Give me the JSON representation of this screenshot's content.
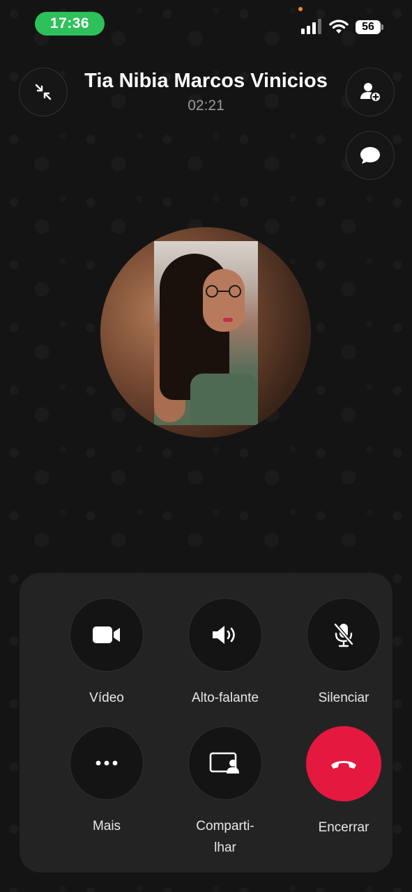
{
  "status_bar": {
    "time": "17:36",
    "battery_level": "56",
    "signal_icon": "cellular-signal-icon",
    "wifi_icon": "wifi-icon"
  },
  "call": {
    "contact_name": "Tia Nibia Marcos Vinicios",
    "duration": "02:21"
  },
  "header_actions": {
    "minimize_icon": "minimize-arrows-icon",
    "add_person_icon": "add-person-icon",
    "chat_icon": "chat-bubble-icon"
  },
  "controls": {
    "video": "Vídeo",
    "speaker": "Alto-falante",
    "mute": "Silenciar",
    "more": "Mais",
    "share_line1": "Comparti-",
    "share_line2": "lhar",
    "end": "Encerrar"
  },
  "colors": {
    "background": "#141414",
    "time_pill": "#2ec05b",
    "end_call": "#e5183f",
    "panel": "#232323"
  }
}
